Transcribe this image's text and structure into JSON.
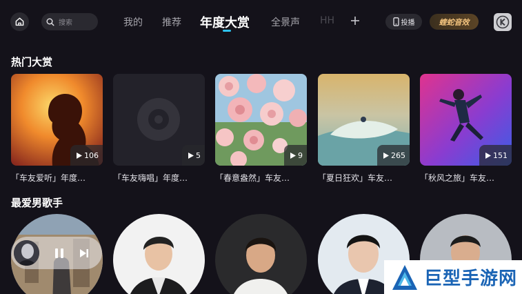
{
  "header": {
    "search_placeholder": "搜索",
    "tabs": [
      {
        "label": "我的"
      },
      {
        "label": "推荐"
      },
      {
        "label": "年度大赏"
      },
      {
        "label": "全景声"
      },
      {
        "label": "HH"
      }
    ],
    "cast_label": "投播",
    "effect_label": "蝰蛇音效",
    "accent_color": "#2ec3f0"
  },
  "hot": {
    "title": "热门大赏",
    "cards": [
      {
        "title": "「车友爱听」年度…",
        "count": "106"
      },
      {
        "title": "「车友嗨唱」年度…",
        "count": "5"
      },
      {
        "title": "「春意盎然」车友…",
        "count": "9"
      },
      {
        "title": "「夏日狂欢」车友…",
        "count": "265"
      },
      {
        "title": "「秋风之旅」车友…",
        "count": "151"
      }
    ]
  },
  "singers": {
    "title": "最爱男歌手"
  },
  "watermark": {
    "text": "巨型手游网"
  }
}
